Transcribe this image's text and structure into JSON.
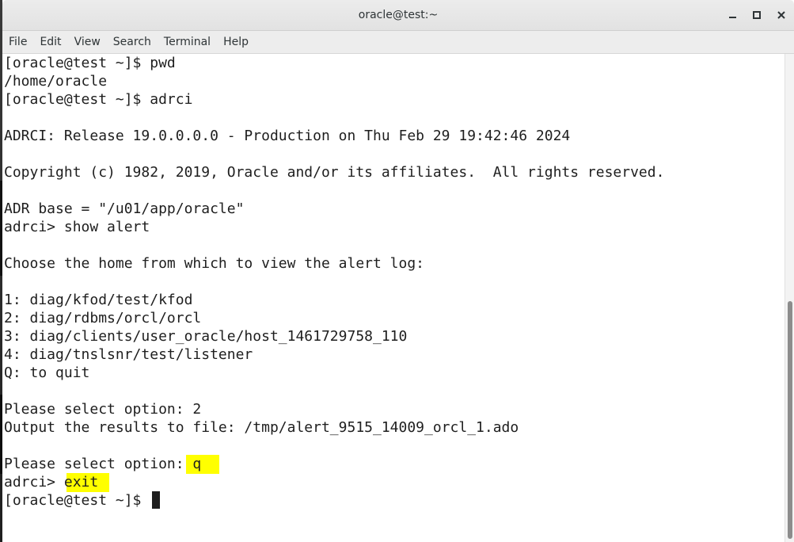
{
  "window": {
    "title": "oracle@test:~"
  },
  "menu": {
    "items": [
      "File",
      "Edit",
      "View",
      "Search",
      "Terminal",
      "Help"
    ]
  },
  "terminal": {
    "lines": [
      "[oracle@test ~]$ pwd",
      "/home/oracle",
      "[oracle@test ~]$ adrci",
      "",
      "ADRCI: Release 19.0.0.0.0 - Production on Thu Feb 29 19:42:46 2024",
      "",
      "Copyright (c) 1982, 2019, Oracle and/or its affiliates.  All rights reserved.",
      "",
      "ADR base = \"/u01/app/oracle\"",
      "adrci> show alert",
      "",
      "Choose the home from which to view the alert log:",
      "",
      "1: diag/kfod/test/kfod",
      "2: diag/rdbms/orcl/orcl",
      "3: diag/clients/user_oracle/host_1461729758_110",
      "4: diag/tnslsnr/test/listener",
      "Q: to quit",
      "",
      "Please select option: 2",
      "Output the results to file: /tmp/alert_9515_14009_orcl_1.ado",
      "",
      "Please select option: q",
      "adrci> exit",
      "[oracle@test ~]$ "
    ]
  },
  "colors": {
    "highlight": "#ffff00",
    "text": "#1e1e1e",
    "background": "#ffffff"
  },
  "icons": {
    "minimize": "minimize-icon",
    "maximize": "maximize-icon",
    "close": "close-icon"
  }
}
